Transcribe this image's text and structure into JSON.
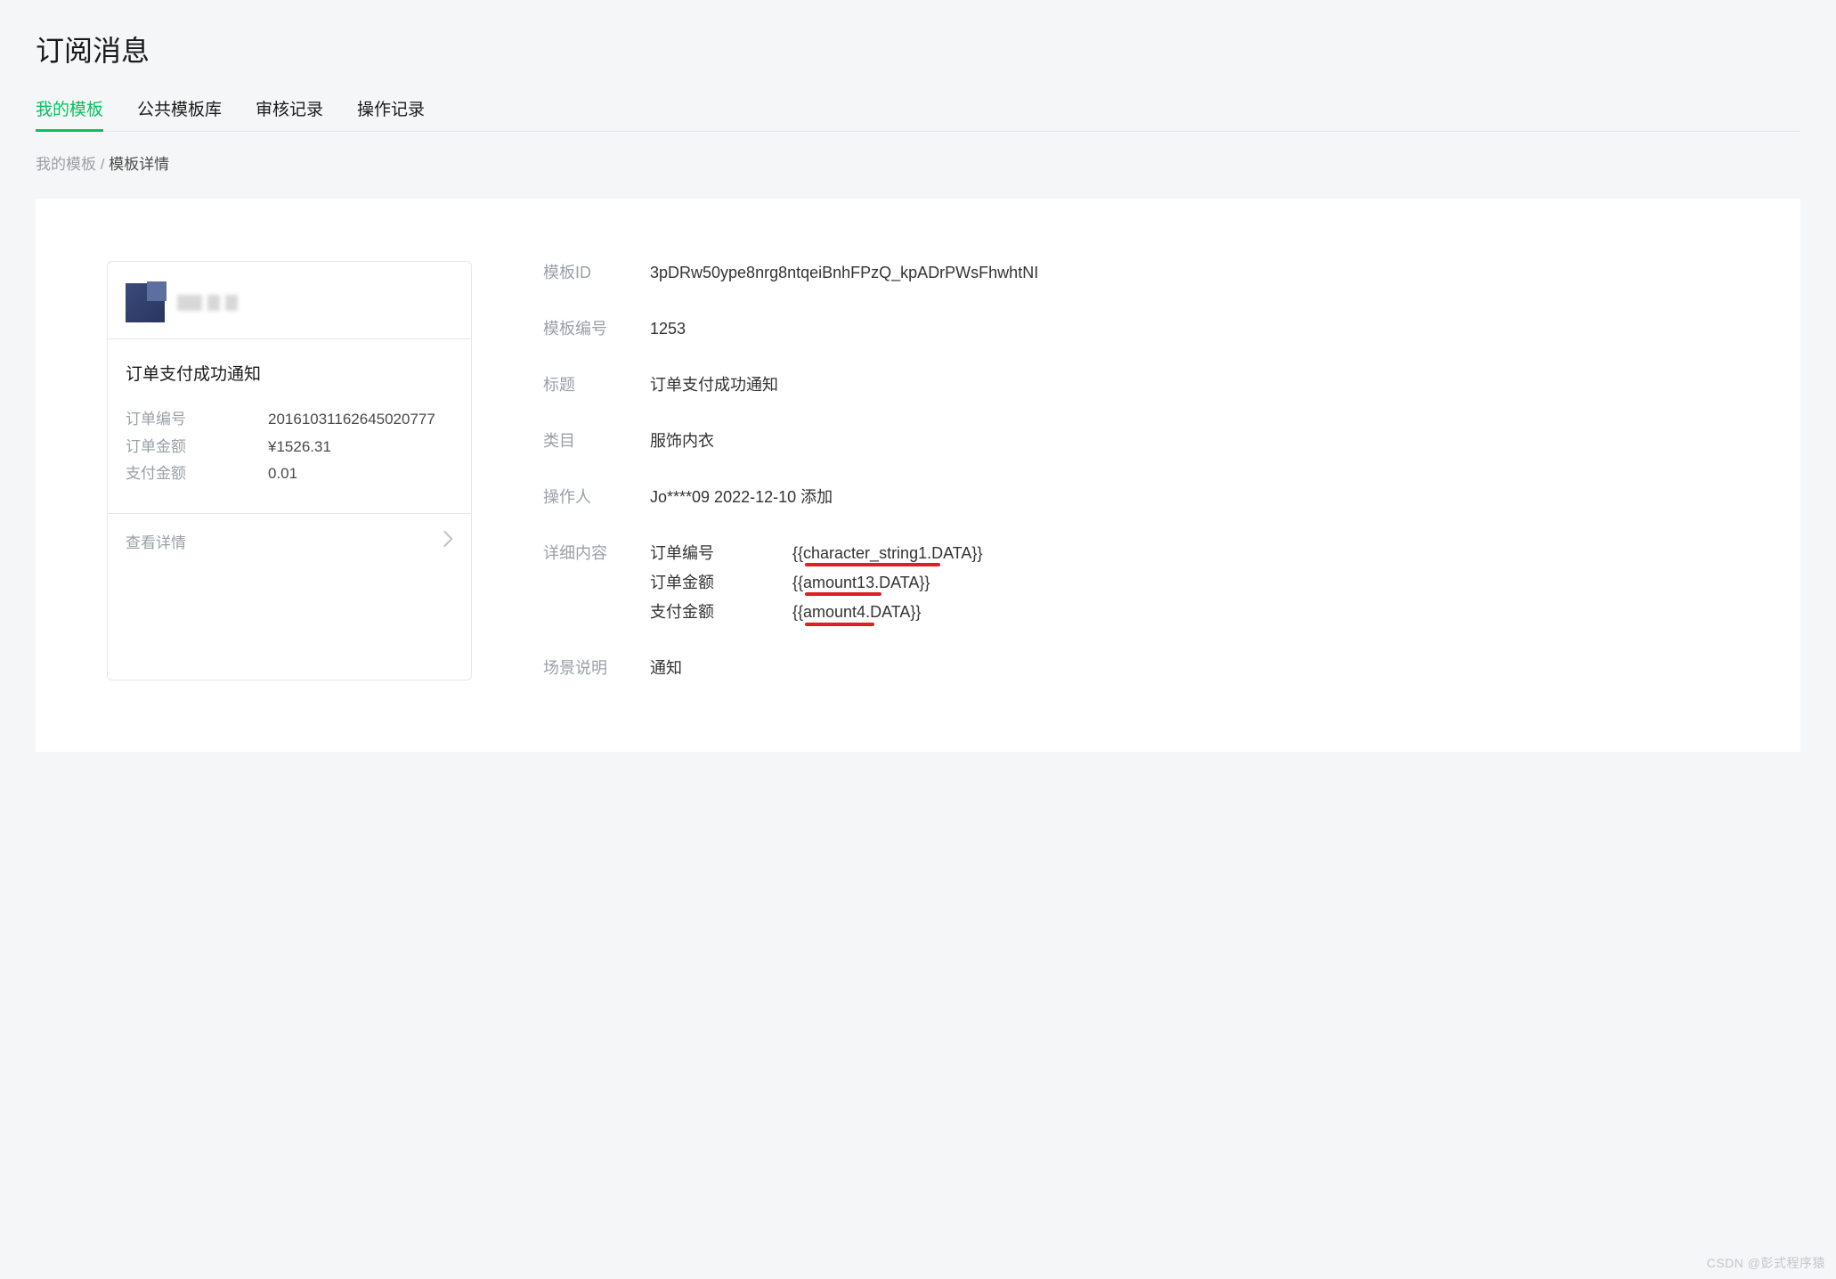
{
  "page": {
    "title": "订阅消息"
  },
  "tabs": {
    "items": [
      {
        "label": "我的模板",
        "active": true
      },
      {
        "label": "公共模板库",
        "active": false
      },
      {
        "label": "审核记录",
        "active": false
      },
      {
        "label": "操作记录",
        "active": false
      }
    ]
  },
  "breadcrumb": {
    "parent": "我的模板",
    "separator": " / ",
    "current": "模板详情"
  },
  "preview": {
    "subject": "订单支付成功通知",
    "rows": [
      {
        "label": "订单编号",
        "value": "20161031162645020777"
      },
      {
        "label": "订单金额",
        "value": "¥1526.31"
      },
      {
        "label": "支付金额",
        "value": "0.01"
      }
    ],
    "footer": "查看详情"
  },
  "details": {
    "template_id_label": "模板ID",
    "template_id": "3pDRw50ype8nrg8ntqeiBnhFPzQ_kpADrPWsFhwhtNI",
    "template_no_label": "模板编号",
    "template_no": "1253",
    "title_label": "标题",
    "title": "订单支付成功通知",
    "category_label": "类目",
    "category": "服饰内衣",
    "operator_label": "操作人",
    "operator": "Jo****09 2022-12-10 添加",
    "content_label": "详细内容",
    "content_rows": [
      {
        "k": "订单编号",
        "v": "{{character_string1.DATA}}"
      },
      {
        "k": "订单金额",
        "v": "{{amount13.DATA}}"
      },
      {
        "k": "支付金额",
        "v": "{{amount4.DATA}}"
      }
    ],
    "scene_label": "场景说明",
    "scene": "通知"
  },
  "watermark": "CSDN @彭式程序猿"
}
